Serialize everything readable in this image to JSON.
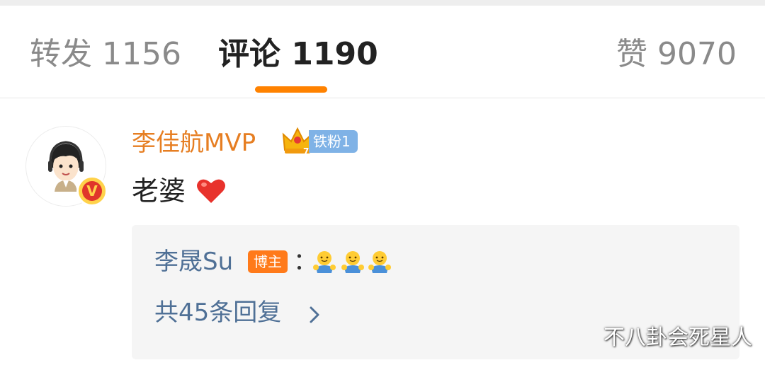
{
  "tabs": {
    "repost": "转发 1156",
    "comments": "评论 1190",
    "likes": "赞 9070"
  },
  "colors": {
    "accent": "#ff8200",
    "username": "#e67e22",
    "reply_link": "#4f7096",
    "fan_badge": "#7fb2e6",
    "blogger_badge": "#ff7a1a"
  },
  "comment": {
    "username": "李佳航MVP",
    "fan_badge": "铁粉1",
    "fan_level": "7",
    "text": "老婆",
    "heart_icon": "red-heart-icon",
    "verified_mark": "V",
    "reply": {
      "author": "李晟Su",
      "author_badge": "博主",
      "colon": "：",
      "emojis": [
        "hug-emoji",
        "hug-emoji",
        "hug-emoji"
      ],
      "view_all": "共45条回复"
    }
  },
  "watermark": "不八卦会死星人"
}
